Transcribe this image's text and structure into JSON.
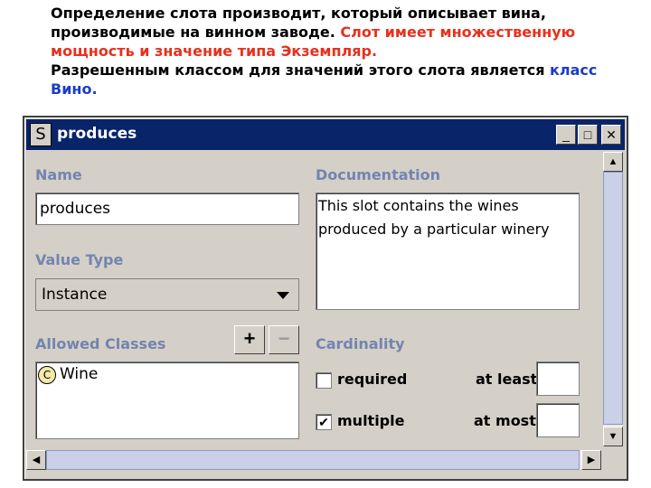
{
  "slide": {
    "para1_black": "Определение слота производит, который описывает вина, производимые на винном заводе. ",
    "para1_red": "Слот имеет множественную мощность и значение типа Экземпляр.",
    "para2_black": "Разрешенным классом для значений этого слота является ",
    "para2_blue": "класс Вино."
  },
  "window": {
    "icon_letter": "S",
    "title": "produces",
    "minimize_glyph": "_",
    "maximize_glyph": "□",
    "close_glyph": "✕"
  },
  "form": {
    "name_label": "Name",
    "name_value": "produces",
    "value_type_label": "Value Type",
    "value_type_value": "Instance",
    "allowed_classes_label": "Allowed Classes",
    "add_glyph": "+",
    "remove_glyph": "−",
    "allowed_classes": [
      {
        "icon_letter": "C",
        "name": "Wine"
      }
    ],
    "documentation_label": "Documentation",
    "documentation_line1": "This slot contains the wines",
    "documentation_line2": "produced by a particular winery",
    "cardinality_label": "Cardinality",
    "required_label": "required",
    "required_checked": false,
    "multiple_label": "multiple",
    "multiple_check": "✔",
    "multiple_checked": true,
    "at_least_label": "at least",
    "at_most_label": "at most"
  },
  "scroll": {
    "up": "▲",
    "down": "▼",
    "left": "◀",
    "right": "▶"
  },
  "colors": {
    "title_bar": "#0a246a",
    "label": "#7384b0",
    "highlight_red": "#e8301c",
    "highlight_blue": "#1a3cc8"
  }
}
